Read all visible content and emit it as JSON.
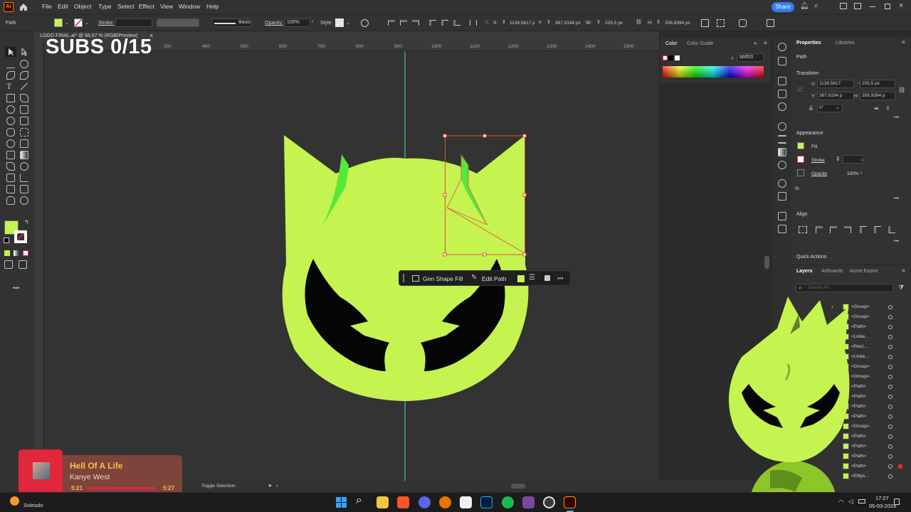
{
  "menubar": {
    "app_badge": "Ai",
    "items": [
      "File",
      "Edit",
      "Object",
      "Type",
      "Select",
      "Effect",
      "View",
      "Window",
      "Help"
    ],
    "share_label": "Share"
  },
  "control_bar": {
    "selection_type": "Path",
    "stroke_label": "Stroke:",
    "brush_label": "Basic",
    "opacity_label": "Opacity:",
    "opacity_value": "100%",
    "style_label": "Style:",
    "x_label": "X:",
    "x_value": "1139,5617 p",
    "y_label": "Y:",
    "y_value": "367,9194 px",
    "w_label": "W:",
    "w_value": "205,5 px",
    "h_label": "H:",
    "h_value": "308,9394 px"
  },
  "document": {
    "tab_title": "LOGO FINAL.ai* @ 66,67 % (RGB/Preview)",
    "close_symbol": "×"
  },
  "overlay": {
    "subs_text": "SUBS 0/15"
  },
  "ruler": {
    "ticks": [
      "300",
      "400",
      "500",
      "600",
      "700",
      "800",
      "900",
      "1000",
      "1100",
      "1200",
      "1300",
      "1400",
      "1500"
    ]
  },
  "context_bar": {
    "gen_shape_fill": "Gen Shape Fill",
    "edit_path": "Edit Path",
    "more": "•••"
  },
  "color_panel": {
    "tab_color": "Color",
    "tab_guide": "Color Guide",
    "hash": "#",
    "hex_value": "bbff00"
  },
  "properties": {
    "tab_properties": "Properties",
    "tab_libraries": "Libraries",
    "object_type": "Path",
    "transform_heading": "Transform",
    "x_label": "X:",
    "x_value": "1139,5617",
    "y_label": "Y:",
    "y_value": "367,9194 p",
    "w_label": "W:",
    "w_value": "205,5 px",
    "h_label": "H:",
    "h_value": "308,9394 p",
    "angle_value": "0°",
    "appearance_heading": "Appearance",
    "fill_label": "Fill",
    "stroke_label": "Stroke",
    "opacity_label": "Opacity",
    "opacity_value": "100%",
    "fx_label": "fx.",
    "align_heading": "Align",
    "quick_actions_heading": "Quick Actions"
  },
  "layers": {
    "tab_layers": "Layers",
    "tab_artboards": "Artboards",
    "tab_asset_export": "Asset Export",
    "search_placeholder": "Search All",
    "rows": [
      "<Group>",
      "<Group>",
      "<Path>",
      "<Linke...",
      "<Rect...",
      "<Linke...",
      "<Group>",
      "<Group>",
      "<Path>",
      "<Path>",
      "<Path>",
      "<Path>",
      "<Group>",
      "<Path>",
      "<Path>",
      "<Path>",
      "<Path>",
      "<Ellips..."
    ]
  },
  "status": {
    "toggle_selection": "Toggle Selection"
  },
  "music": {
    "song_title": "Hell Of A Life",
    "artist": "Kanye West",
    "elapsed": "5:21",
    "duration": "5:27",
    "progress": 0.98
  },
  "taskbar": {
    "weather": "Soleado",
    "time": "17:27",
    "date": "05-03-2026"
  },
  "colors": {
    "lime": "#c5f34f",
    "bright_green": "#53e83a",
    "selection": "#e0503a",
    "guide": "#4fd6c0",
    "music_red": "#e0283a"
  }
}
